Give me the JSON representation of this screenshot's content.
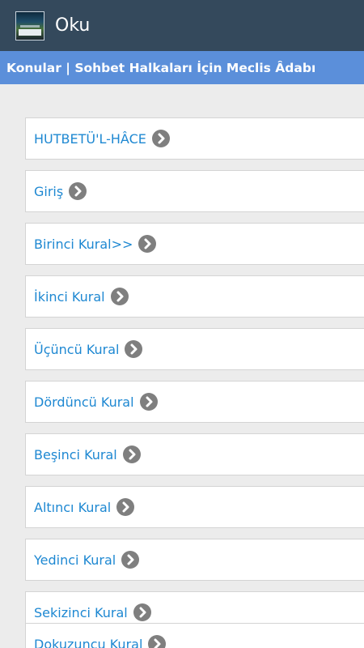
{
  "actionbar": {
    "title": "Oku",
    "app_icon": "book-cover-icon"
  },
  "subheader": {
    "title": "Konular | Sohbet Halkaları İçin Meclis Âdabı"
  },
  "list": {
    "items": [
      {
        "label": "HUTBETÜ'L-HÂCE"
      },
      {
        "label": "Giriş"
      },
      {
        "label": "Birinci Kural>>"
      },
      {
        "label": "İkinci Kural"
      },
      {
        "label": "Üçüncü Kural"
      },
      {
        "label": "Dördüncü Kural"
      },
      {
        "label": "Beşinci Kural"
      },
      {
        "label": "Altıncı Kural"
      },
      {
        "label": "Yedinci Kural"
      },
      {
        "label": "Sekizinci Kural"
      },
      {
        "label": "Dokuzuncu Kural"
      }
    ],
    "item_icon": "chevron-right-circle-icon"
  },
  "colors": {
    "actionbar_bg": "#34495c",
    "subheader_bg": "#5b8fda",
    "link_text": "#1e88d2",
    "chevron": "#7f7f7f",
    "page_bg": "#ececec"
  }
}
